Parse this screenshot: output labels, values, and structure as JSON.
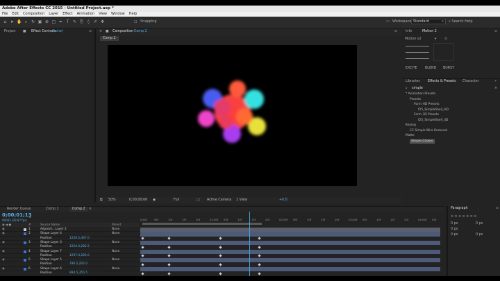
{
  "window": {
    "title": "Adobe After Effects CC 2015 - Untitled Project.aep *"
  },
  "menu": [
    "File",
    "Edit",
    "Composition",
    "Layer",
    "Effect",
    "Animation",
    "View",
    "Window",
    "Help"
  ],
  "toolbar": {
    "snapping": "Snapping",
    "workspace_label": "Workspace:",
    "workspace_value": "Standard",
    "search_placeholder": "Search Help"
  },
  "left_panel": {
    "tab_project": "Project",
    "tab_effect_controls": "Effect Controls",
    "effect_layer": "(none)"
  },
  "comp_panel": {
    "title": "Composition",
    "comp_name": "Comp 2",
    "sub_tab": "Comp 2",
    "footer": {
      "zoom": "50%",
      "timecode": "0;00;00;06",
      "resolution": "Full",
      "camera": "Active Camera",
      "views": "1 View",
      "exposure": "+0.0"
    }
  },
  "right_top": {
    "tab_info": "Info",
    "tab_motion": "Motion 2",
    "preset": "Motion v2",
    "buttons": [
      "EXCITE",
      "BLEND",
      "BURST"
    ]
  },
  "right_mid": {
    "tabs": [
      "Libraries",
      "Effects & Presets",
      "Character"
    ],
    "search": "simple",
    "tree": [
      {
        "label": "* Animation Presets",
        "indent": 0
      },
      {
        "label": "Presets",
        "indent": 1
      },
      {
        "label": "Form HD Presets",
        "indent": 2
      },
      {
        "label": "f25_SimpleShell_HD",
        "indent": 3
      },
      {
        "label": "Form 3D Presets",
        "indent": 2
      },
      {
        "label": "f25_SimpleShell_3D",
        "indent": 3
      },
      {
        "label": "Keying",
        "indent": 0
      },
      {
        "label": "CC Simple Wire Removal",
        "indent": 1
      },
      {
        "label": "Matte",
        "indent": 0
      },
      {
        "label": "Simple Choker",
        "indent": 1,
        "highlight": true
      }
    ]
  },
  "timeline": {
    "tabs": [
      "Render Queue",
      "Comp 1",
      "Comp 2"
    ],
    "timecode": "0;00;01;13",
    "frames": "00043 (29.97 fps)",
    "headers": {
      "num": "#",
      "name": "Source Name",
      "parent": "Parent"
    },
    "ruler": [
      "0;00f",
      "05f",
      "10f",
      "15f",
      "20f",
      "01;00f",
      "05f",
      "10f",
      "15f",
      "20f",
      "02;00f",
      "05f",
      "10f",
      "15f",
      "20f",
      "03;00f",
      "05f",
      "10f",
      "15f",
      "20f",
      "04;00f",
      "05f"
    ],
    "toggle_label": "Toggle Switches / Modes",
    "rows": [
      {
        "type": "layer",
        "num": "1",
        "name": "Adjustm...Layer 2",
        "parent": "None",
        "color": "#c8c8c8"
      },
      {
        "type": "layer",
        "num": "2",
        "name": "Shape Layer 4",
        "parent": "None",
        "color": "#3b73d6"
      },
      {
        "type": "prop",
        "name": "Position",
        "value": "1226.5,467.0"
      },
      {
        "type": "layer",
        "num": "3",
        "name": "Shape Layer 3",
        "parent": "None",
        "color": "#3b73d6"
      },
      {
        "type": "prop",
        "name": "Position",
        "value": "1224.0,282.5"
      },
      {
        "type": "layer",
        "num": "4",
        "name": "Shape Layer 7",
        "parent": "None",
        "color": "#3b73d6"
      },
      {
        "type": "prop",
        "name": "Position",
        "value": "1297.0,283.0"
      },
      {
        "type": "layer",
        "num": "5",
        "name": "Shape Layer 5",
        "parent": "None",
        "color": "#3b73d6"
      },
      {
        "type": "prop",
        "name": "Position",
        "value": "790.5,202.0"
      },
      {
        "type": "layer",
        "num": "6",
        "name": "Shape Layer 6",
        "parent": "None",
        "color": "#3b73d6"
      },
      {
        "type": "prop",
        "name": "Position",
        "value": "894.5,355.5"
      }
    ]
  },
  "paragraph": {
    "tab": "Paragraph",
    "fields": [
      "0 px",
      "0 px",
      "0 px",
      "0 px",
      "0 px"
    ]
  }
}
